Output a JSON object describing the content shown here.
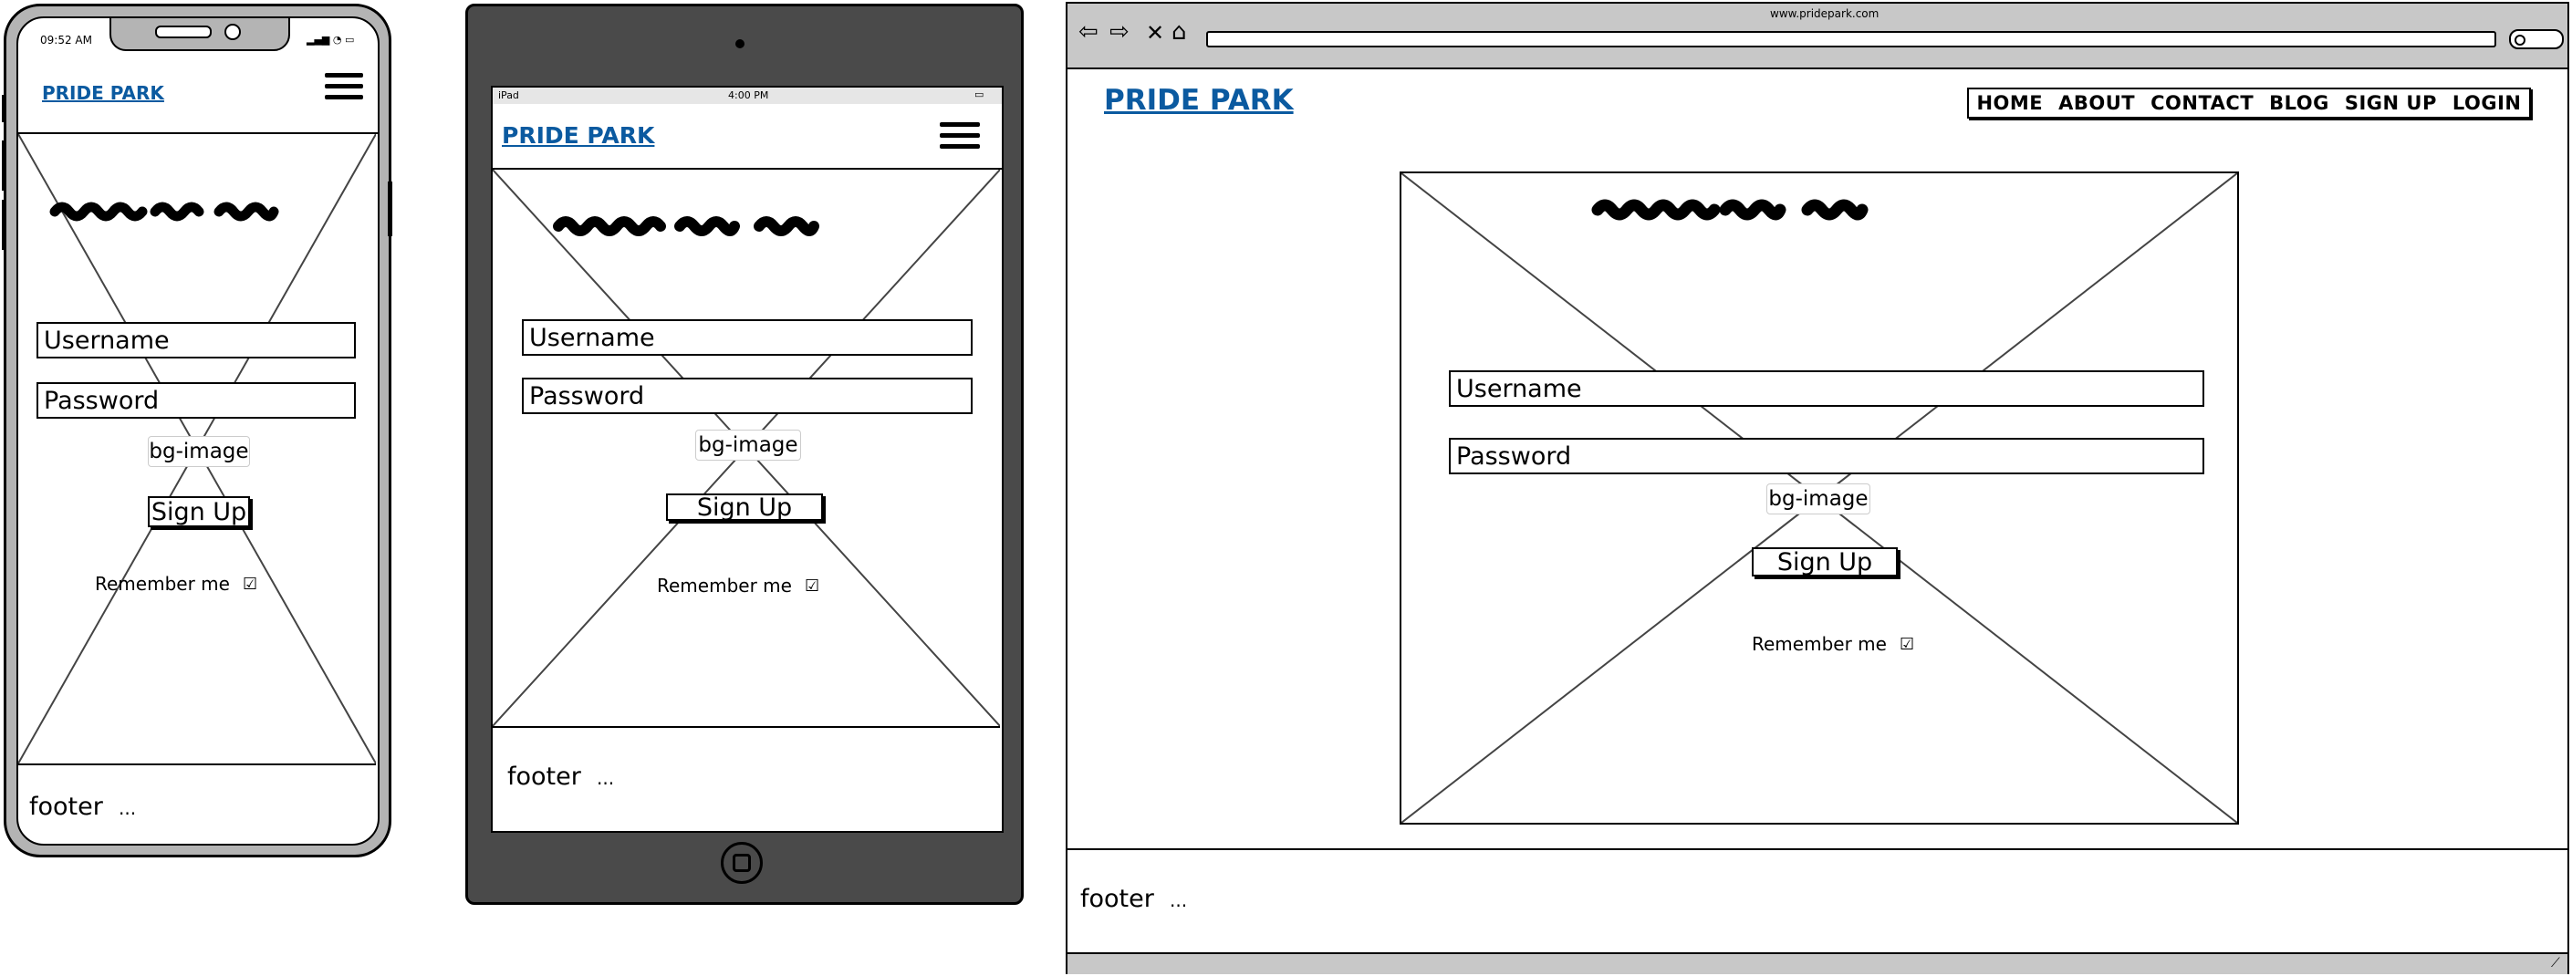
{
  "phone": {
    "status_time": "09:52 AM",
    "logo": "PRIDE PARK",
    "username_placeholder": "Username",
    "password_placeholder": "Password",
    "bg_label": "bg-image",
    "signup_label": "Sign Up",
    "remember_label": "Remember me",
    "checkbox_glyph": "☑",
    "footer_text": "footer",
    "footer_dots": "..."
  },
  "tablet": {
    "status_device": "iPad",
    "status_time": "4:00 PM",
    "logo": "PRIDE PARK",
    "username_placeholder": "Username",
    "password_placeholder": "Password",
    "bg_label": "bg-image",
    "signup_label": "Sign Up",
    "remember_label": "Remember me",
    "checkbox_glyph": "☑",
    "footer_text": "footer",
    "footer_dots": "..."
  },
  "desktop": {
    "url": "www.pridepark.com",
    "logo": "PRIDE PARK",
    "nav": [
      "HOME",
      "ABOUT",
      "CONTACT",
      "BLOG",
      "SIGN UP",
      "LOGIN"
    ],
    "username_placeholder": "Username",
    "password_placeholder": "Password",
    "bg_label": "bg-image",
    "signup_label": "Sign Up",
    "remember_label": "Remember me",
    "checkbox_glyph": "☑",
    "footer_text": "footer",
    "footer_dots": "..."
  },
  "colors": {
    "logo": "#0b5aa0",
    "tablet_body": "#4a4a4a",
    "phone_body": "#b4b4b4",
    "browser_chrome": "#c8c8c8"
  }
}
